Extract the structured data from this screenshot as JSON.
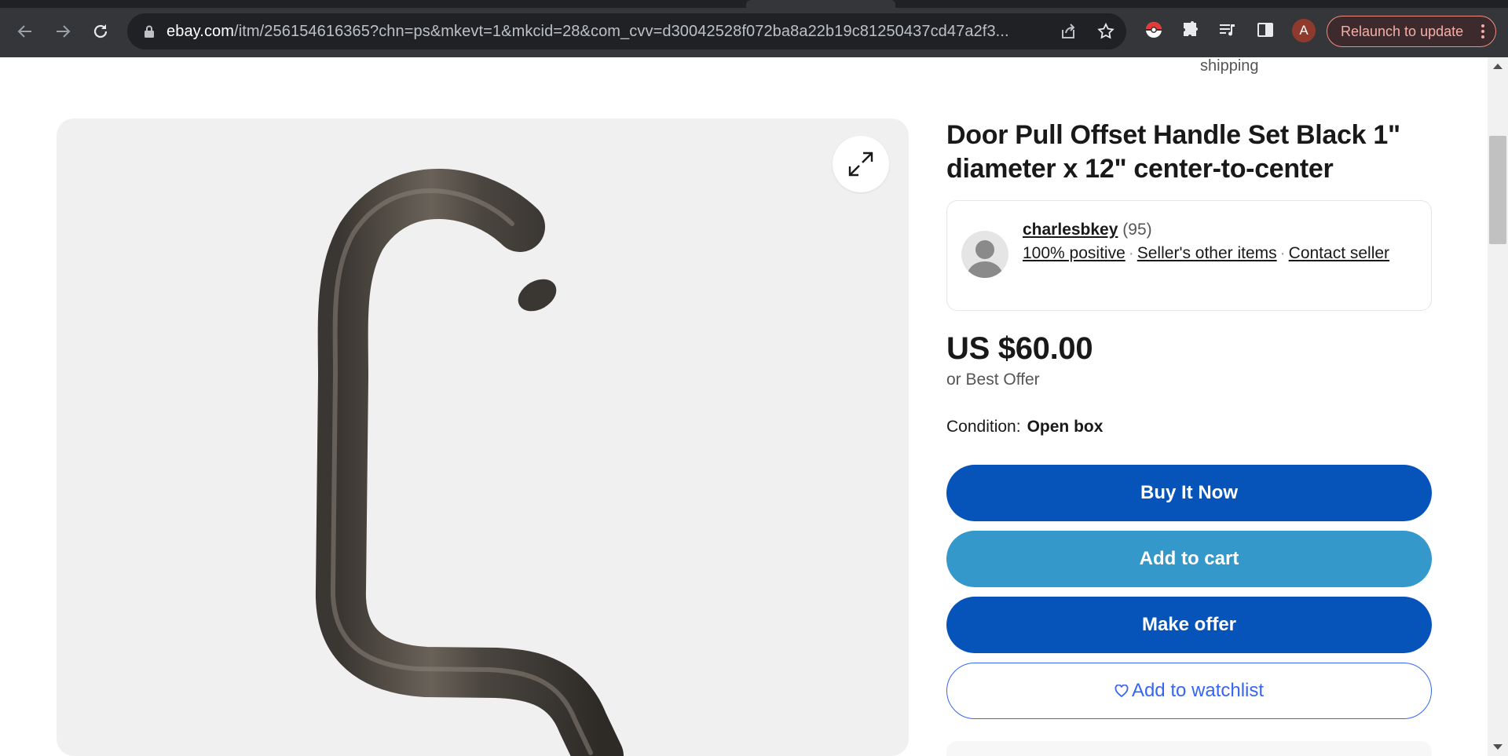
{
  "browser": {
    "url_host": "ebay.com",
    "url_path": "/itm/256154616365?chn=ps&mkevt=1&mkcid=28&com_cvv=d30042528f072ba8a22b19c81250437cd47a2f3...",
    "profile_initial": "A",
    "relaunch_label": "Relaunch to update",
    "icons": [
      "back-icon",
      "forward-icon",
      "reload-icon",
      "lock-icon",
      "share-icon",
      "star-icon",
      "pokeball-extension-icon",
      "puzzle-extension-icon",
      "media-queue-icon",
      "side-panel-icon",
      "kebab-menu-icon"
    ]
  },
  "page": {
    "shipping_fragment": "shipping",
    "listing": {
      "title": "Door Pull Offset Handle Set Black 1\" diameter x 12\" center-to-center",
      "price": "US $60.00",
      "best_offer": "or Best Offer",
      "condition_label": "Condition:",
      "condition_value": "Open box"
    },
    "seller": {
      "name": "charlesbkey",
      "feedback_count": "(95)",
      "positive": "100% positive",
      "other_items": "Seller's other items",
      "contact": "Contact seller"
    },
    "actions": {
      "buy_now": "Buy It Now",
      "add_to_cart": "Add to cart",
      "make_offer": "Make offer",
      "watchlist": "Add to watchlist"
    }
  },
  "colors": {
    "buy_now": "#0654ba",
    "add_to_cart": "#3498ca",
    "watchlist_text": "#3665f3",
    "relaunch_border": "#f28b82"
  }
}
